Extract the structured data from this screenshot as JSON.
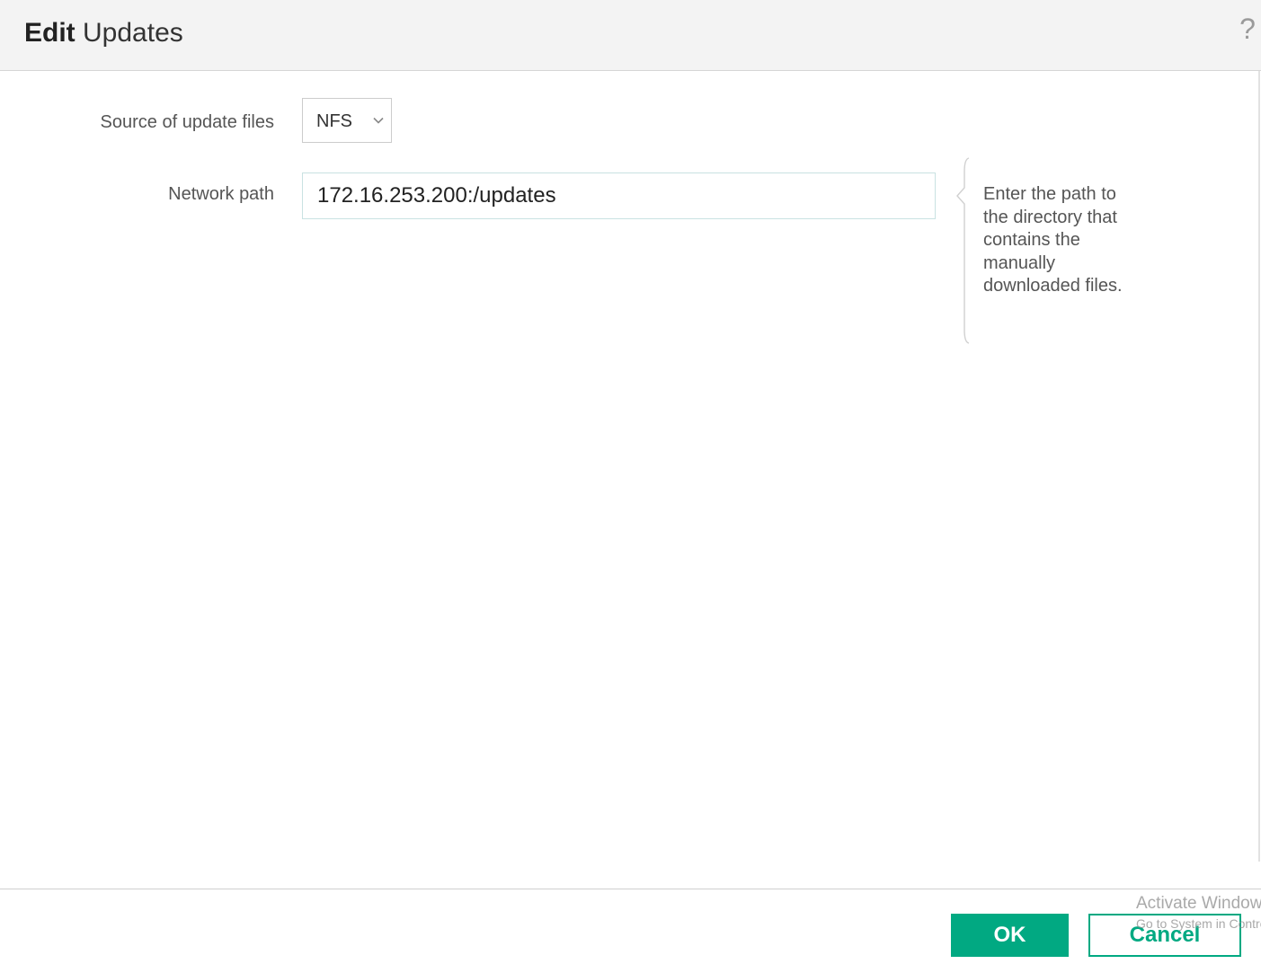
{
  "header": {
    "title_bold": "Edit",
    "title_rest": "Updates",
    "help_glyph": "?"
  },
  "form": {
    "source_label": "Source of update files",
    "source_value": "NFS",
    "network_path_label": "Network path",
    "network_path_value": "172.16.253.200:/updates",
    "help_text": "Enter the path to the directory that contains the manually downloaded files."
  },
  "footer": {
    "ok_label": "OK",
    "cancel_label": "Cancel"
  },
  "watermark": {
    "line1": "Activate Windows",
    "line2": "Go to System in Control Panel"
  },
  "colors": {
    "accent": "#01a982",
    "header_bg": "#f3f3f3"
  },
  "icons": {
    "help": "help-icon",
    "dropdown": "chevron-down-icon",
    "callout": "bracket-icon"
  }
}
